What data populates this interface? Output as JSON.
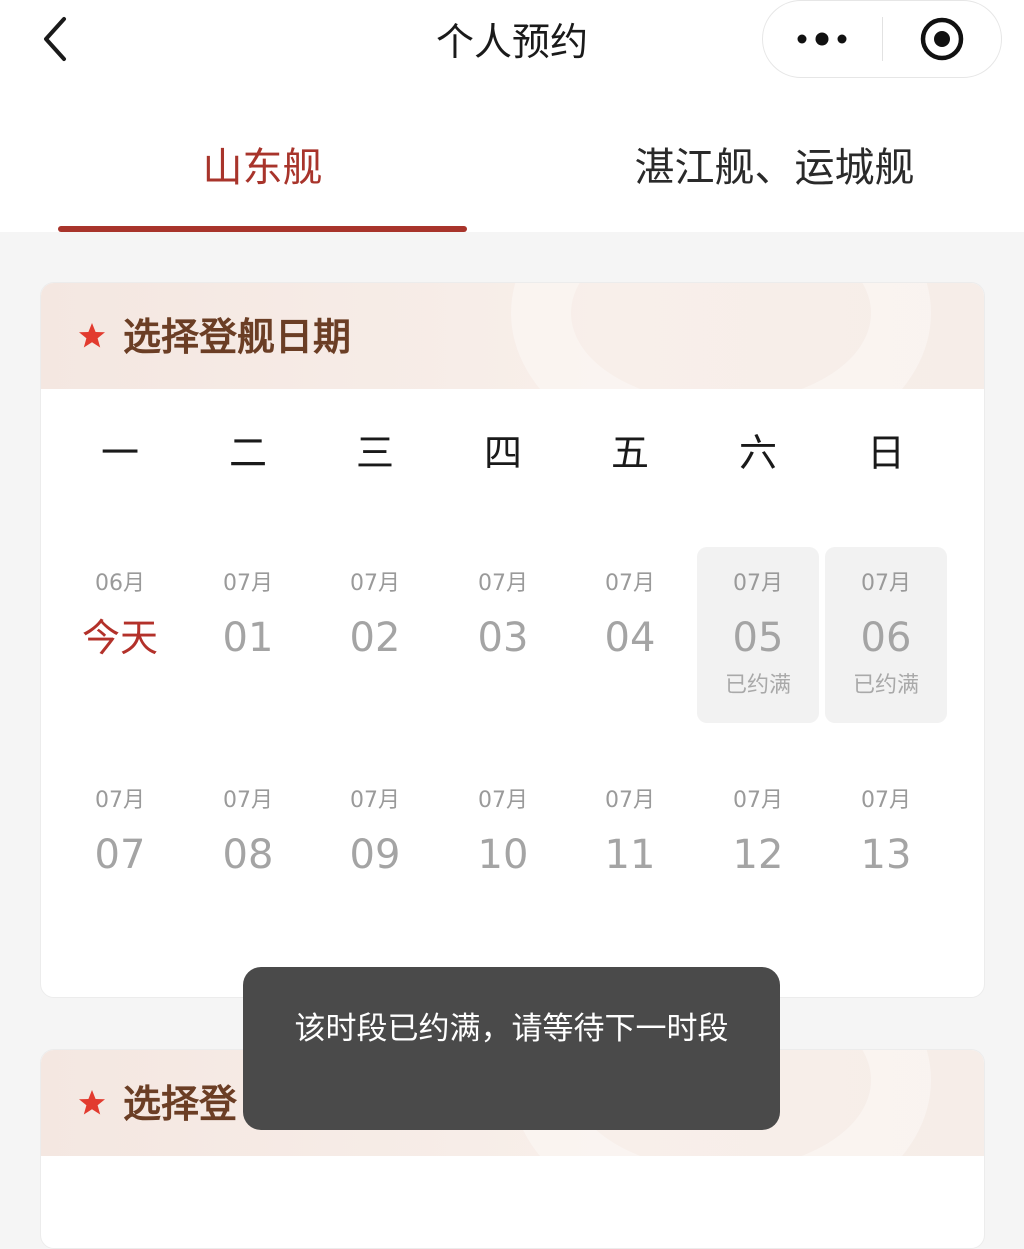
{
  "header": {
    "title": "个人预约",
    "back_icon": "chevron-left-icon",
    "more_icon": "more-dots-icon",
    "target_icon": "target-icon"
  },
  "tabs": [
    {
      "label": "山东舰",
      "active": true
    },
    {
      "label": "湛江舰、运城舰",
      "active": false
    }
  ],
  "colors": {
    "accent": "#a8342b",
    "title_brown": "#6b3e25",
    "star_red": "#e23b2f",
    "toast_bg": "#4a4a4a"
  },
  "date_section": {
    "title": "选择登舰日期",
    "weekdays": [
      "一",
      "二",
      "三",
      "四",
      "五",
      "六",
      "日"
    ],
    "rows": [
      [
        {
          "month": "06月",
          "day": "今天",
          "today": true,
          "status": ""
        },
        {
          "month": "07月",
          "day": "01",
          "status": ""
        },
        {
          "month": "07月",
          "day": "02",
          "status": ""
        },
        {
          "month": "07月",
          "day": "03",
          "status": ""
        },
        {
          "month": "07月",
          "day": "04",
          "status": ""
        },
        {
          "month": "07月",
          "day": "05",
          "status": "已约满",
          "full": true
        },
        {
          "month": "07月",
          "day": "06",
          "status": "已约满",
          "full": true
        }
      ],
      [
        {
          "month": "07月",
          "day": "07",
          "status": ""
        },
        {
          "month": "07月",
          "day": "08",
          "status": ""
        },
        {
          "month": "07月",
          "day": "09",
          "status": ""
        },
        {
          "month": "07月",
          "day": "10",
          "status": ""
        },
        {
          "month": "07月",
          "day": "11",
          "status": ""
        },
        {
          "month": "07月",
          "day": "12",
          "status": ""
        },
        {
          "month": "07月",
          "day": "13",
          "status": ""
        }
      ]
    ]
  },
  "second_section": {
    "title_visible": "选择登"
  },
  "toast": {
    "message": "该时段已约满，请等待下一时段"
  }
}
